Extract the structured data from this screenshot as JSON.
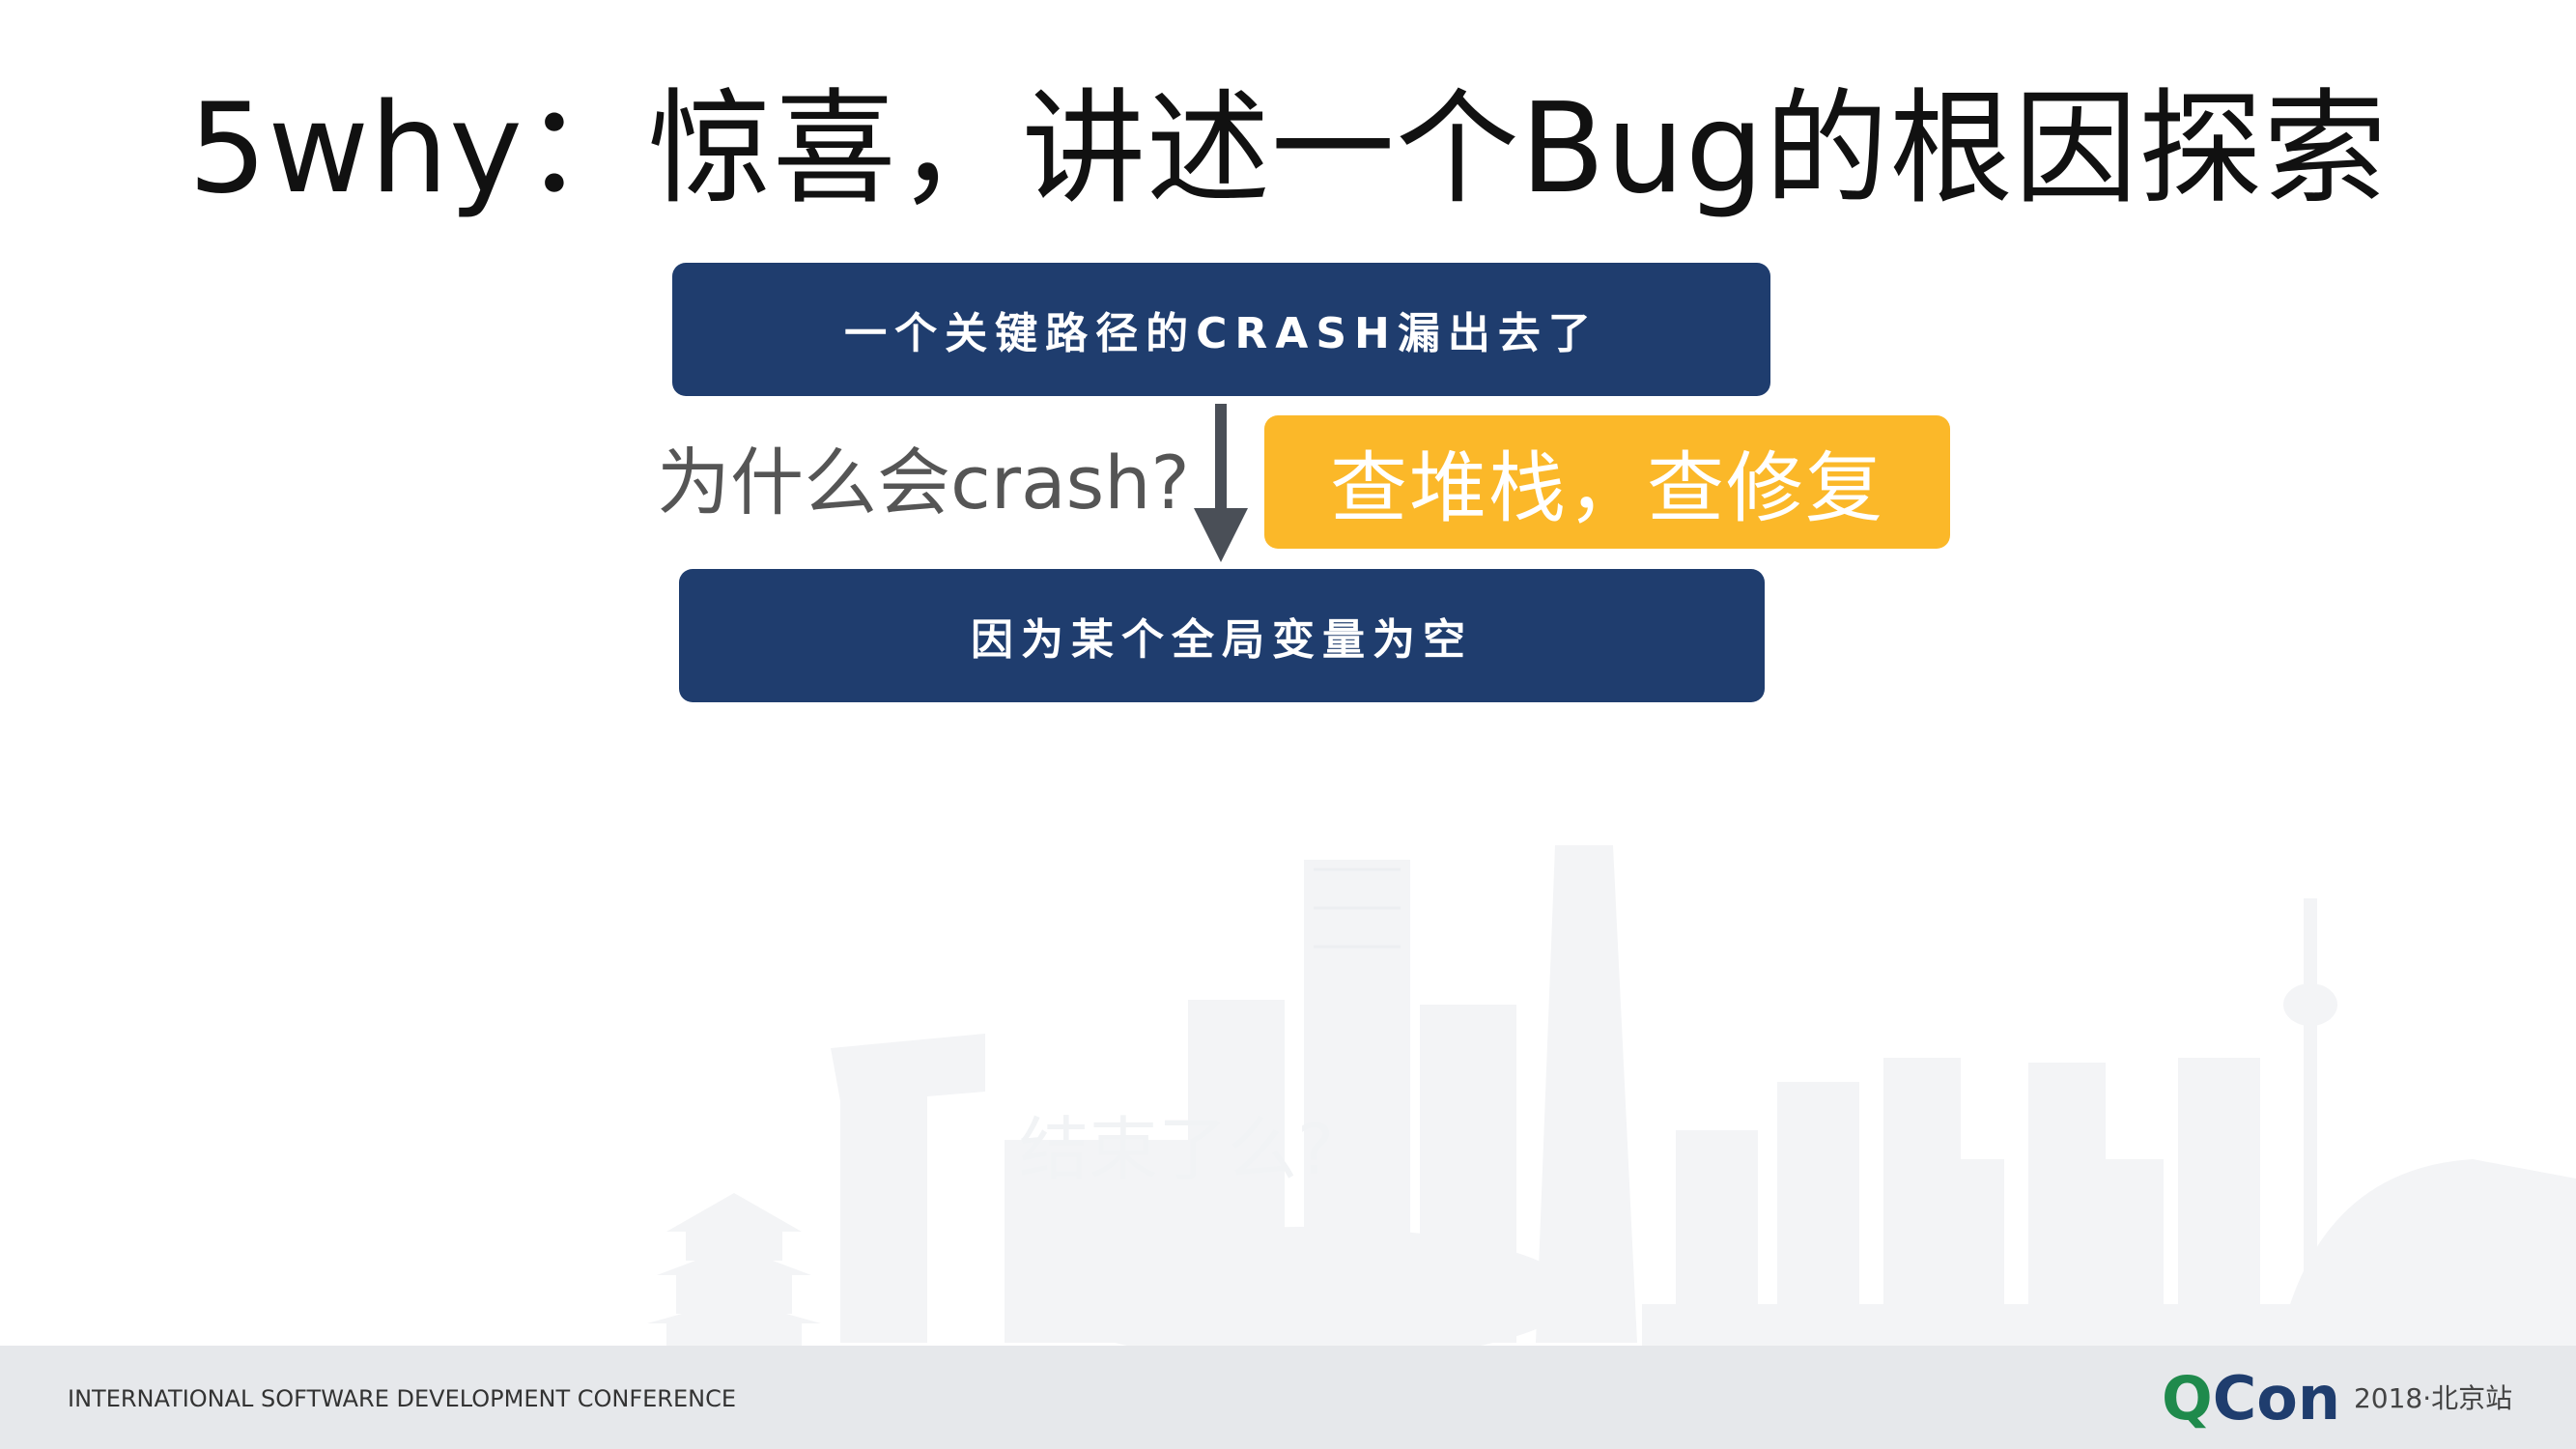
{
  "title": "5why：惊喜，讲述一个Bug的根因探索",
  "flow": {
    "top_box": "一个关键路径的CRASH漏出去了",
    "question": "为什么会crash?",
    "fix_note": "查堆栈，查修复",
    "bottom_box": "因为某个全局变量为空",
    "faded_question": "结束了么?"
  },
  "footer": {
    "conference": "INTERNATIONAL SOFTWARE DEVELOPMENT CONFERENCE",
    "logo_q": "Q",
    "logo_con": "Con",
    "logo_sub": "2018·北京站"
  },
  "colors": {
    "box_blue": "#1f3d6e",
    "highlight_yellow": "#fbb829",
    "arrow_gray": "#4a4f57",
    "logo_green": "#1f8a4c"
  },
  "icons": {
    "arrow": "down-arrow-icon",
    "background": "beijing-skyline-illustration"
  }
}
